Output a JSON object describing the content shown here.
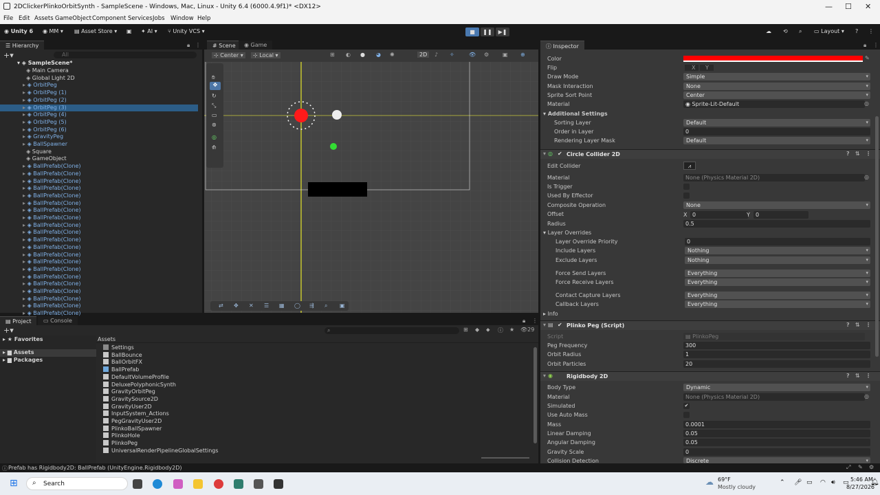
{
  "window": {
    "title": "2DClickerPlinkoOrbitSynth - SampleScene - Windows, Mac, Linux - Unity 6.4 (6000.4.9f1)* <DX12>"
  },
  "menu": [
    "File",
    "Edit",
    "Assets",
    "GameObject",
    "Component",
    "Services",
    "Jobs",
    "Window",
    "Help"
  ],
  "toolbar": {
    "account": "Unity 6",
    "user": "MM",
    "asset_store": "Asset Store",
    "ai": "AI",
    "vcs": "Unity VCS",
    "layout": "Layout"
  },
  "hierarchy": {
    "tab": "Hierarchy",
    "search_placeholder": "All",
    "scene": "SampleScene*",
    "items": [
      "Main Camera",
      "Global Light 2D",
      "OrbitPeg",
      "OrbitPeg (1)",
      "OrbitPeg (2)",
      "OrbitPeg (3)",
      "OrbitPeg (4)",
      "OrbitPeg (5)",
      "OrbitPeg (6)",
      "GravityPeg",
      "BallSpawner",
      "Square",
      "GameObject",
      "BallPrefab(Clone)",
      "BallPrefab(Clone)",
      "BallPrefab(Clone)",
      "BallPrefab(Clone)",
      "BallPrefab(Clone)",
      "BallPrefab(Clone)",
      "BallPrefab(Clone)",
      "BallPrefab(Clone)",
      "BallPrefab(Clone)",
      "BallPrefab(Clone)",
      "BallPrefab(Clone)",
      "BallPrefab(Clone)",
      "BallPrefab(Clone)",
      "BallPrefab(Clone)",
      "BallPrefab(Clone)",
      "BallPrefab(Clone)",
      "BallPrefab(Clone)",
      "BallPrefab(Clone)",
      "BallPrefab(Clone)",
      "BallPrefab(Clone)",
      "BallPrefab(Clone)",
      "BallPrefab(Clone)",
      "BallPrefab(Clone)"
    ],
    "selected": "OrbitPeg (3)"
  },
  "scene": {
    "tabs": [
      "Scene",
      "Game"
    ],
    "pivot": "Center",
    "space": "Local",
    "mode_2d": "2D"
  },
  "inspector": {
    "tab": "Inspector",
    "color_label": "Color",
    "color_value": "#ff0000",
    "flip_label": "Flip",
    "flip_x": "X",
    "flip_y": "Y",
    "draw_mode_label": "Draw Mode",
    "draw_mode": "Simple",
    "mask_label": "Mask Interaction",
    "mask": "None",
    "sort_point_label": "Sprite Sort Point",
    "sort_point": "Center",
    "material_label": "Material",
    "material": "Sprite-Lit-Default",
    "additional": "Additional Settings",
    "sorting_layer_label": "Sorting Layer",
    "sorting_layer": "Default",
    "order_label": "Order in Layer",
    "order": "0",
    "rlm_label": "Rendering Layer Mask",
    "rlm": "Default",
    "collider": {
      "title": "Circle Collider 2D",
      "edit": "Edit Collider",
      "material_label": "Material",
      "material": "None (Physics Material 2D)",
      "trigger": "Is Trigger",
      "effector": "Used By Effector",
      "composite_label": "Composite Operation",
      "composite": "None",
      "offset_label": "Offset",
      "offset_x_label": "X",
      "offset_x": "0",
      "offset_y_label": "Y",
      "offset_y": "0",
      "radius_label": "Radius",
      "radius": "0.5",
      "overrides": "Layer Overrides",
      "priority_label": "Layer Override Priority",
      "priority": "0",
      "include_label": "Include Layers",
      "include": "Nothing",
      "exclude_label": "Exclude Layers",
      "exclude": "Nothing",
      "force_send_label": "Force Send Layers",
      "force_send": "Everything",
      "force_recv_label": "Force Receive Layers",
      "force_recv": "Everything",
      "contact_label": "Contact Capture Layers",
      "contact": "Everything",
      "callback_label": "Callback Layers",
      "callback": "Everything",
      "info": "Info"
    },
    "script": {
      "title": "Plinko Peg (Script)",
      "script_label": "Script",
      "script": "PlinkoPeg",
      "freq_label": "Peg Frequency",
      "freq": "300",
      "radius_label": "Orbit Radius",
      "radius": "1",
      "particles_label": "Orbit Particles",
      "particles": "20"
    },
    "rigidbody": {
      "title": "Rigidbody 2D",
      "body_label": "Body Type",
      "body": "Dynamic",
      "material_label": "Material",
      "material": "None (Physics Material 2D)",
      "simulated_label": "Simulated",
      "auto_mass_label": "Use Auto Mass",
      "mass_label": "Mass",
      "mass": "0.0001",
      "linear_label": "Linear Damping",
      "linear": "0.05",
      "angular_label": "Angular Damping",
      "angular": "0.05",
      "gravity_label": "Gravity Scale",
      "gravity": "0",
      "collision_label": "Collision Detection",
      "collision": "Discrete"
    }
  },
  "project": {
    "tabs": [
      "Project",
      "Console"
    ],
    "favorites": "Favorites",
    "assets": "Assets",
    "packages": "Packages",
    "breadcrumb": "Assets",
    "count": "29",
    "items": [
      "Settings",
      "BallBounce",
      "BallOrbitFX",
      "BallPrefab",
      "DefaultVolumeProfile",
      "DeluxePolyphonicSynth",
      "GravityOrbitPeg",
      "GravitySource2D",
      "GravityUser2D",
      "InputSystem_Actions",
      "PegGravityUser2D",
      "PlinkoBallSpawner",
      "PlinkoHole",
      "PlinkoPeg",
      "UniversalRenderPipelineGlobalSettings"
    ]
  },
  "status": "Prefab has Rigidbody2D: BallPrefab (UnityEngine.Rigidbody2D)",
  "taskbar": {
    "search": "Search",
    "temp": "69°F",
    "weather": "Mostly cloudy",
    "time": "5:46 AM",
    "date": "8/27/2026"
  }
}
